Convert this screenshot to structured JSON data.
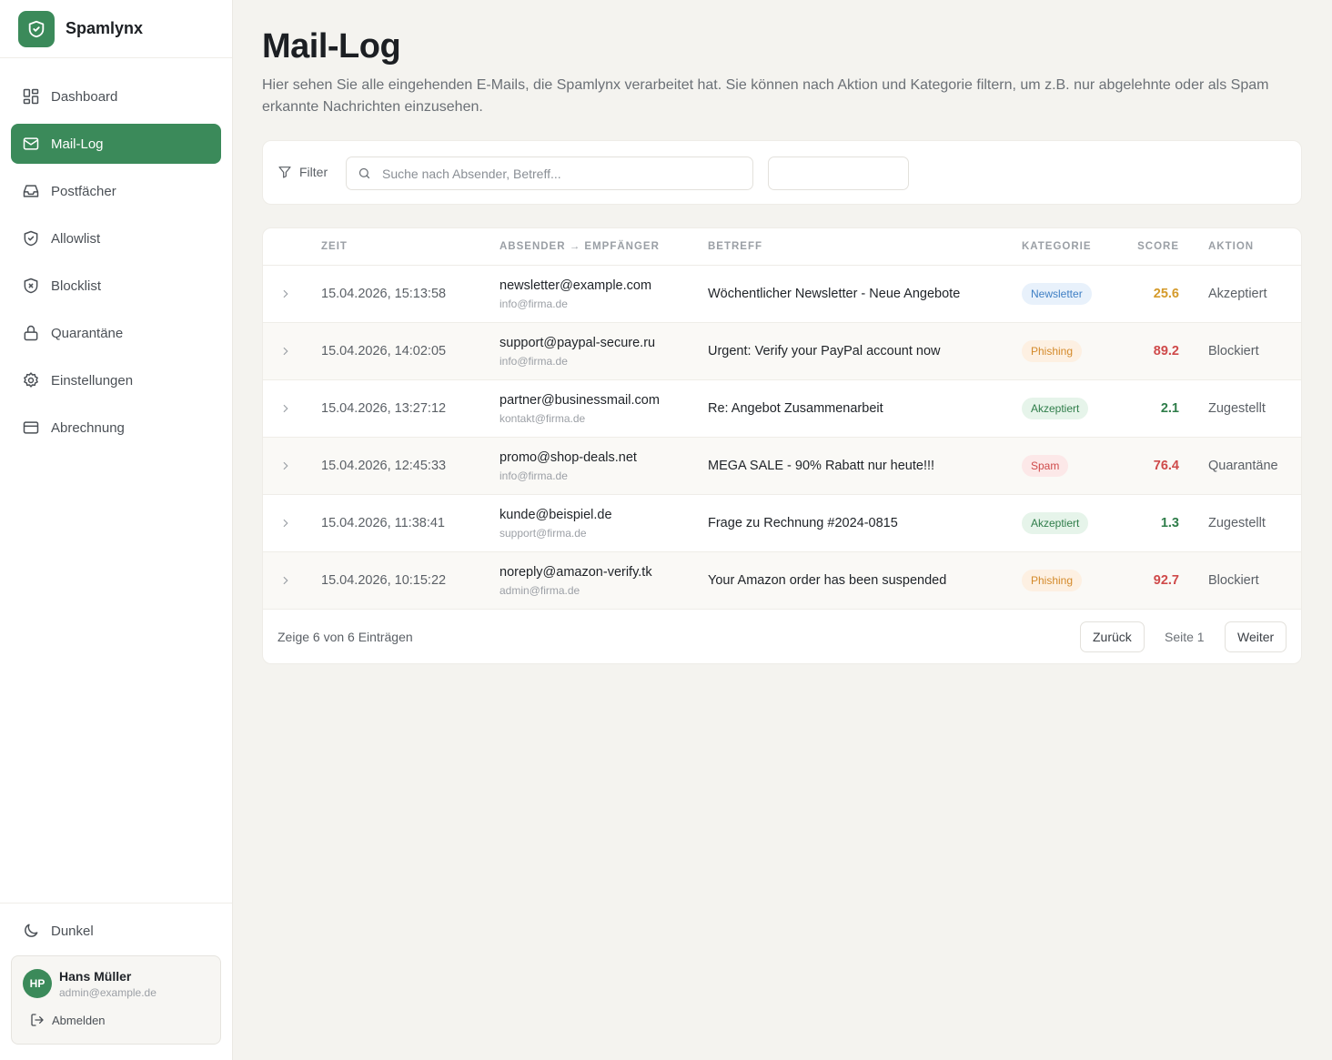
{
  "app": {
    "name": "Spamlynx"
  },
  "nav": {
    "items": [
      {
        "label": "Dashboard",
        "icon": "dashboard-icon",
        "active": false
      },
      {
        "label": "Mail-Log",
        "icon": "mail-icon",
        "active": true
      },
      {
        "label": "Postfächer",
        "icon": "inbox-icon",
        "active": false
      },
      {
        "label": "Allowlist",
        "icon": "shield-check-icon",
        "active": false
      },
      {
        "label": "Blocklist",
        "icon": "shield-x-icon",
        "active": false
      },
      {
        "label": "Quarantäne",
        "icon": "lock-icon",
        "active": false
      },
      {
        "label": "Einstellungen",
        "icon": "gear-icon",
        "active": false
      },
      {
        "label": "Abrechnung",
        "icon": "credit-card-icon",
        "active": false
      }
    ]
  },
  "theme": {
    "label": "Dunkel"
  },
  "user": {
    "initials": "HP",
    "name": "Hans Müller",
    "email": "admin@example.de",
    "logout_label": "Abmelden"
  },
  "page": {
    "title": "Mail-Log",
    "description": "Hier sehen Sie alle eingehenden E-Mails, die Spamlynx verarbeitet hat. Sie können nach Aktion und Kategorie filtern, um z.B. nur abgelehnte oder als Spam erkannte Nachrichten einzusehen."
  },
  "filter": {
    "label": "Filter",
    "search_placeholder": "Suche nach Absender, Betreff...",
    "search_value": ""
  },
  "table": {
    "headers": {
      "time": "Zeit",
      "from_to": "Absender → Empfänger",
      "subject": "Betreff",
      "category": "Kategorie",
      "score": "Score",
      "action": "Aktion"
    },
    "rows": [
      {
        "time": "15.04.2026, 15:13:58",
        "sender": "newsletter@example.com",
        "recipient": "info@firma.de",
        "subject": "Wöchentlicher Newsletter - Neue Angebote",
        "category": "Newsletter",
        "score": "25.6",
        "action": "Akzeptiert"
      },
      {
        "time": "15.04.2026, 14:02:05",
        "sender": "support@paypal-secure.ru",
        "recipient": "info@firma.de",
        "subject": "Urgent: Verify your PayPal account now",
        "category": "Phishing",
        "score": "89.2",
        "action": "Blockiert"
      },
      {
        "time": "15.04.2026, 13:27:12",
        "sender": "partner@businessmail.com",
        "recipient": "kontakt@firma.de",
        "subject": "Re: Angebot Zusammenarbeit",
        "category": "Akzeptiert",
        "score": "2.1",
        "action": "Zugestellt"
      },
      {
        "time": "15.04.2026, 12:45:33",
        "sender": "promo@shop-deals.net",
        "recipient": "info@firma.de",
        "subject": "MEGA SALE - 90% Rabatt nur heute!!!",
        "category": "Spam",
        "score": "76.4",
        "action": "Quarantäne"
      },
      {
        "time": "15.04.2026, 11:38:41",
        "sender": "kunde@beispiel.de",
        "recipient": "support@firma.de",
        "subject": "Frage zu Rechnung #2024-0815",
        "category": "Akzeptiert",
        "score": "1.3",
        "action": "Zugestellt"
      },
      {
        "time": "15.04.2026, 10:15:22",
        "sender": "noreply@amazon-verify.tk",
        "recipient": "admin@firma.de",
        "subject": "Your Amazon order has been suspended",
        "category": "Phishing",
        "score": "92.7",
        "action": "Blockiert"
      }
    ]
  },
  "pagination": {
    "summary": "Zeige 6 von 6 Einträgen",
    "prev_label": "Zurück",
    "page_label": "Seite 1",
    "next_label": "Weiter"
  },
  "colors": {
    "accent": "#3b8a5a",
    "badge_newsletter_bg": "#e8f1fb",
    "badge_newsletter_fg": "#3f7fc4",
    "badge_phishing_bg": "#fdf0e2",
    "badge_phishing_fg": "#d48a2a",
    "badge_accepted_bg": "#e6f4ea",
    "badge_accepted_fg": "#2f7d4a",
    "badge_spam_bg": "#fce8e8",
    "badge_spam_fg": "#cf4a4a",
    "score_low": "#2f7d4a",
    "score_mid": "#d49a2a",
    "score_high": "#cf4a4a"
  }
}
